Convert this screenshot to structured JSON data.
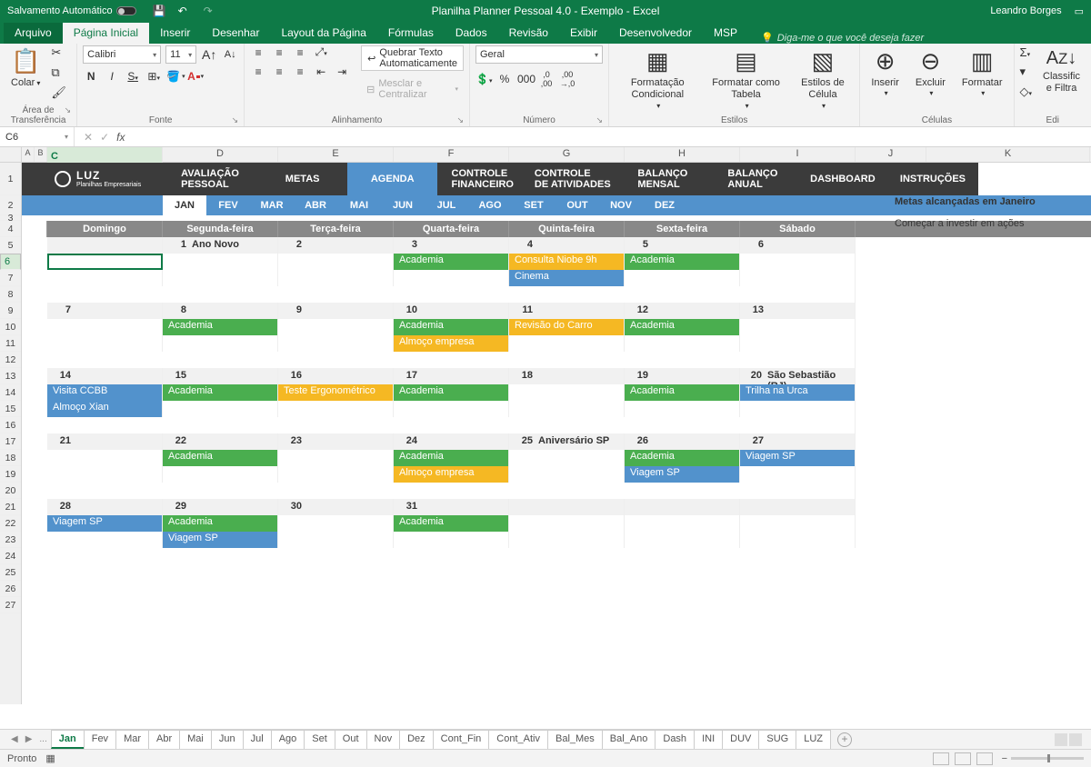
{
  "title_bar": {
    "autosave": "Salvamento Automático",
    "title": "Planilha Planner Pessoal 4.0 - Exemplo  -  Excel",
    "user": "Leandro Borges"
  },
  "ribbon_tabs": {
    "file": "Arquivo",
    "home": "Página Inicial",
    "insert": "Inserir",
    "draw": "Desenhar",
    "layout": "Layout da Página",
    "formulas": "Fórmulas",
    "data": "Dados",
    "review": "Revisão",
    "view": "Exibir",
    "developer": "Desenvolvedor",
    "msp": "MSP",
    "tellme": "Diga-me o que você deseja fazer"
  },
  "ribbon": {
    "clipboard": {
      "paste": "Colar",
      "title": "Área de Transferência"
    },
    "font": {
      "name": "Calibri",
      "size": "11",
      "title": "Fonte"
    },
    "alignment": {
      "wrap": "Quebrar Texto Automaticamente",
      "merge": "Mesclar e Centralizar",
      "title": "Alinhamento"
    },
    "number": {
      "format": "Geral",
      "title": "Número"
    },
    "styles": {
      "cond": "Formatação Condicional",
      "table": "Formatar como Tabela",
      "cell": "Estilos de Célula",
      "title": "Estilos"
    },
    "cells": {
      "insert": "Inserir",
      "delete": "Excluir",
      "format": "Formatar",
      "title": "Células"
    },
    "editing": {
      "sort": "Classific",
      "filter": "e Filtra",
      "title": "Edi"
    }
  },
  "cellbar": {
    "name": "C6",
    "formula": ""
  },
  "col_headers": [
    "A",
    "B",
    "C",
    "D",
    "E",
    "F",
    "G",
    "H",
    "I",
    "J",
    "K"
  ],
  "nav": {
    "logo_brand": "LUZ",
    "logo_sub": "Planilhas Empresariais",
    "items": [
      "AVALIAÇÃO PESSOAL",
      "METAS",
      "AGENDA",
      "CONTROLE FINANCEIRO",
      "CONTROLE DE ATIVIDADES",
      "BALANÇO MENSAL",
      "BALANÇO ANUAL",
      "DASHBOARD",
      "INSTRUÇÕES"
    ],
    "active": 2
  },
  "months": [
    "JAN",
    "FEV",
    "MAR",
    "ABR",
    "MAI",
    "JUN",
    "JUL",
    "AGO",
    "SET",
    "OUT",
    "NOV",
    "DEZ"
  ],
  "month_active": 0,
  "cal_days": [
    "Domingo",
    "Segunda-feira",
    "Terça-feira",
    "Quarta-feira",
    "Quinta-feira",
    "Sexta-feira",
    "Sábado"
  ],
  "weeks": [
    {
      "row": 5,
      "days": [
        {
          "n": "",
          "label": ""
        },
        {
          "n": "1",
          "label": "Ano Novo"
        },
        {
          "n": "2",
          "label": ""
        },
        {
          "n": "3",
          "label": ""
        },
        {
          "n": "4",
          "label": ""
        },
        {
          "n": "5",
          "label": ""
        },
        {
          "n": "6",
          "label": ""
        }
      ],
      "events": [
        [
          {
            "t": "",
            "c": "selected"
          },
          {
            "t": "",
            "c": "empty"
          },
          {
            "t": "",
            "c": "empty"
          },
          {
            "t": "Academia",
            "c": "green"
          },
          {
            "t": "Consulta Niobe 9h",
            "c": "orange"
          },
          {
            "t": "Academia",
            "c": "green"
          },
          {
            "t": "",
            "c": "empty"
          }
        ],
        [
          {
            "t": "",
            "c": "empty"
          },
          {
            "t": "",
            "c": "empty"
          },
          {
            "t": "",
            "c": "empty"
          },
          {
            "t": "",
            "c": "empty"
          },
          {
            "t": "Cinema",
            "c": "blue"
          },
          {
            "t": "",
            "c": "empty"
          },
          {
            "t": "",
            "c": "empty"
          }
        ]
      ]
    },
    {
      "row": 9,
      "days": [
        {
          "n": "7",
          "label": ""
        },
        {
          "n": "8",
          "label": ""
        },
        {
          "n": "9",
          "label": ""
        },
        {
          "n": "10",
          "label": ""
        },
        {
          "n": "11",
          "label": ""
        },
        {
          "n": "12",
          "label": ""
        },
        {
          "n": "13",
          "label": ""
        }
      ],
      "events": [
        [
          {
            "t": "",
            "c": "empty"
          },
          {
            "t": "Academia",
            "c": "green"
          },
          {
            "t": "",
            "c": "empty"
          },
          {
            "t": "Academia",
            "c": "green"
          },
          {
            "t": "Revisão do Carro",
            "c": "orange"
          },
          {
            "t": "Academia",
            "c": "green"
          },
          {
            "t": "",
            "c": "empty"
          }
        ],
        [
          {
            "t": "",
            "c": "empty"
          },
          {
            "t": "",
            "c": "empty"
          },
          {
            "t": "",
            "c": "empty"
          },
          {
            "t": "Almoço empresa",
            "c": "orange"
          },
          {
            "t": "",
            "c": "empty"
          },
          {
            "t": "",
            "c": "empty"
          },
          {
            "t": "",
            "c": "empty"
          }
        ]
      ]
    },
    {
      "row": 13,
      "days": [
        {
          "n": "14",
          "label": ""
        },
        {
          "n": "15",
          "label": ""
        },
        {
          "n": "16",
          "label": ""
        },
        {
          "n": "17",
          "label": ""
        },
        {
          "n": "18",
          "label": ""
        },
        {
          "n": "19",
          "label": ""
        },
        {
          "n": "20",
          "label": "São Sebastião (RJ)"
        }
      ],
      "events": [
        [
          {
            "t": "Visita CCBB",
            "c": "blue"
          },
          {
            "t": "Academia",
            "c": "green"
          },
          {
            "t": "Teste Ergonométrico",
            "c": "orange"
          },
          {
            "t": "Academia",
            "c": "green"
          },
          {
            "t": "",
            "c": "empty"
          },
          {
            "t": "Academia",
            "c": "green"
          },
          {
            "t": "Trilha na Urca",
            "c": "blue"
          }
        ],
        [
          {
            "t": "Almoço Xian",
            "c": "blue"
          },
          {
            "t": "",
            "c": "empty"
          },
          {
            "t": "",
            "c": "empty"
          },
          {
            "t": "",
            "c": "empty"
          },
          {
            "t": "",
            "c": "empty"
          },
          {
            "t": "",
            "c": "empty"
          },
          {
            "t": "",
            "c": "empty"
          }
        ]
      ]
    },
    {
      "row": 17,
      "days": [
        {
          "n": "21",
          "label": ""
        },
        {
          "n": "22",
          "label": ""
        },
        {
          "n": "23",
          "label": ""
        },
        {
          "n": "24",
          "label": ""
        },
        {
          "n": "25",
          "label": "Aniversário SP"
        },
        {
          "n": "26",
          "label": ""
        },
        {
          "n": "27",
          "label": ""
        }
      ],
      "events": [
        [
          {
            "t": "",
            "c": "empty"
          },
          {
            "t": "Academia",
            "c": "green"
          },
          {
            "t": "",
            "c": "empty"
          },
          {
            "t": "Academia",
            "c": "green"
          },
          {
            "t": "",
            "c": "empty"
          },
          {
            "t": "Academia",
            "c": "green"
          },
          {
            "t": "Viagem SP",
            "c": "blue"
          }
        ],
        [
          {
            "t": "",
            "c": "empty"
          },
          {
            "t": "",
            "c": "empty"
          },
          {
            "t": "",
            "c": "empty"
          },
          {
            "t": "Almoço empresa",
            "c": "orange"
          },
          {
            "t": "",
            "c": "empty"
          },
          {
            "t": "Viagem SP",
            "c": "blue"
          },
          {
            "t": "",
            "c": "empty"
          }
        ]
      ]
    },
    {
      "row": 21,
      "days": [
        {
          "n": "28",
          "label": ""
        },
        {
          "n": "29",
          "label": ""
        },
        {
          "n": "30",
          "label": ""
        },
        {
          "n": "31",
          "label": ""
        },
        {
          "n": "",
          "label": ""
        },
        {
          "n": "",
          "label": ""
        },
        {
          "n": "",
          "label": ""
        }
      ],
      "events": [
        [
          {
            "t": "Viagem SP",
            "c": "blue"
          },
          {
            "t": "Academia",
            "c": "green"
          },
          {
            "t": "",
            "c": "empty"
          },
          {
            "t": "Academia",
            "c": "green"
          },
          {
            "t": "",
            "c": "empty"
          },
          {
            "t": "",
            "c": "empty"
          },
          {
            "t": "",
            "c": "empty"
          }
        ],
        [
          {
            "t": "",
            "c": "empty"
          },
          {
            "t": "Viagem SP",
            "c": "blue"
          },
          {
            "t": "",
            "c": "empty"
          },
          {
            "t": "",
            "c": "empty"
          },
          {
            "t": "",
            "c": "empty"
          },
          {
            "t": "",
            "c": "empty"
          },
          {
            "t": "",
            "c": "empty"
          }
        ]
      ]
    }
  ],
  "side": {
    "title": "Metas alcançadas em Janeiro",
    "item1": "Começar a investir em ações"
  },
  "sheet_tabs": [
    "Jan",
    "Fev",
    "Mar",
    "Abr",
    "Mai",
    "Jun",
    "Jul",
    "Ago",
    "Set",
    "Out",
    "Nov",
    "Dez",
    "Cont_Fin",
    "Cont_Ativ",
    "Bal_Mes",
    "Bal_Ano",
    "Dash",
    "INI",
    "DUV",
    "SUG",
    "LUZ"
  ],
  "sheet_tabs_dots": "...",
  "sheet_active": 0,
  "status": {
    "ready": "Pronto"
  }
}
